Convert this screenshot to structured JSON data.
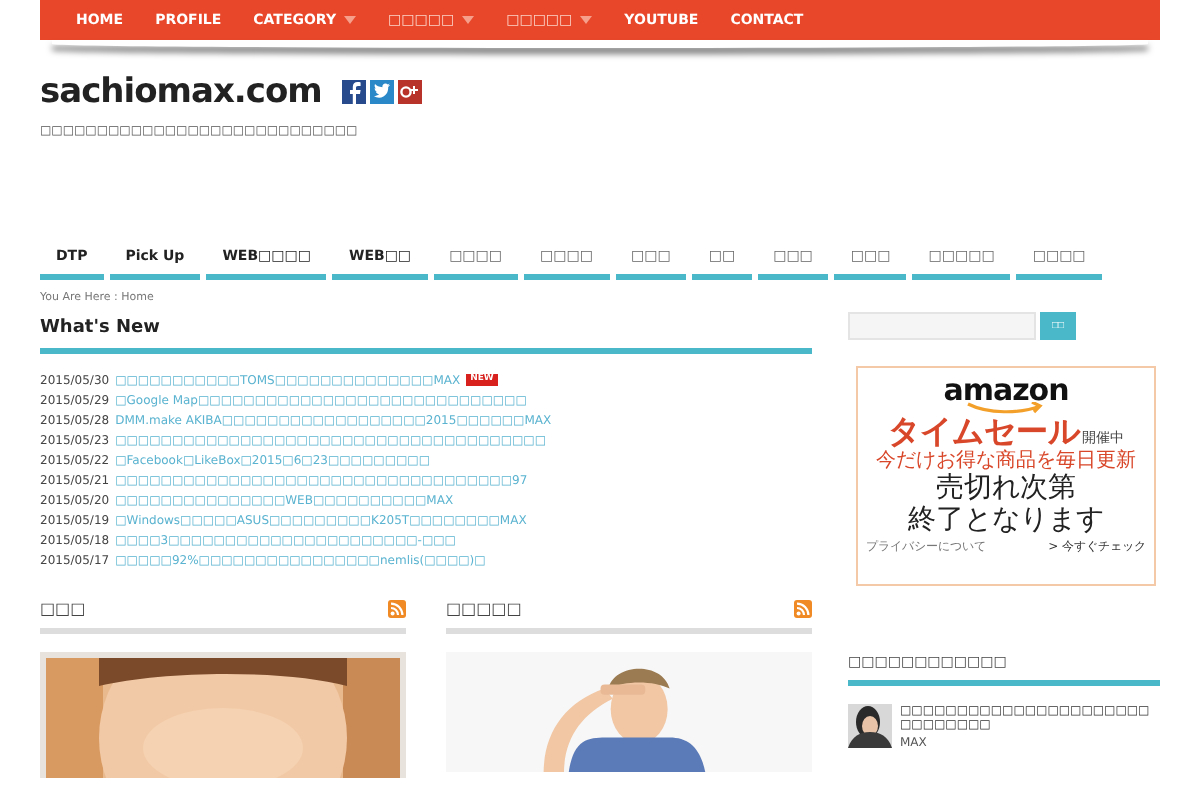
{
  "nav": [
    {
      "label": "HOME",
      "has_menu": false
    },
    {
      "label": "PROFILE",
      "has_menu": false
    },
    {
      "label": "CATEGORY",
      "has_menu": true
    },
    {
      "label": "□□□□□",
      "has_menu": true
    },
    {
      "label": "□□□□□",
      "has_menu": true
    },
    {
      "label": "YOUTUBE",
      "has_menu": false
    },
    {
      "label": "CONTACT",
      "has_menu": false
    }
  ],
  "site": {
    "title": "sachiomax.com",
    "tagline": "□□□□□□□□□□□□□□□□□□□□□□□□□□□□"
  },
  "categories": [
    "DTP",
    "Pick Up",
    "WEB□□□□",
    "WEB□□",
    "□□□□",
    "□□□□",
    "□□□",
    "□□",
    "□□□",
    "□□□",
    "□□□□□",
    "□□□□"
  ],
  "breadcrumb": "You Are Here : Home",
  "whats_new": {
    "title": "What's New",
    "items": [
      {
        "date": "2015/05/30",
        "title": "□□□□□□□□□□□TOMS□□□□□□□□□□□□□□MAX",
        "new": true
      },
      {
        "date": "2015/05/29",
        "title": "□Google Map□□□□□□□□□□□□□□□□□□□□□□□□□□□□□",
        "new": false
      },
      {
        "date": "2015/05/28",
        "title": "DMM.make AKIBA□□□□□□□□□□□□□□□□□□2015□□□□□□MAX",
        "new": false
      },
      {
        "date": "2015/05/23",
        "title": "□□□□□□□□□□□□□□□□□□□□□□□□□□□□□□□□□□□□□□",
        "new": false
      },
      {
        "date": "2015/05/22",
        "title": "□Facebook□LikeBox□2015□6□23□□□□□□□□□",
        "new": false
      },
      {
        "date": "2015/05/21",
        "title": "□□□□□□□□□□□□□□□□□□□□□□□□□□□□□□□□□□□97",
        "new": false
      },
      {
        "date": "2015/05/20",
        "title": "□□□□□□□□□□□□□□□WEB□□□□□□□□□□MAX",
        "new": false
      },
      {
        "date": "2015/05/19",
        "title": "□Windows□□□□□ASUS□□□□□□□□□K205T□□□□□□□□MAX",
        "new": false
      },
      {
        "date": "2015/05/18",
        "title": "□□□□3□□□□□□□□□□□□□□□□□□□□□□-□□□",
        "new": false
      },
      {
        "date": "2015/05/17",
        "title": "□□□□□92%□□□□□□□□□□□□□□□□nemlis(□□□□)□",
        "new": false
      }
    ]
  },
  "new_badge": "NEW",
  "sections": [
    {
      "title": "□□□"
    },
    {
      "title": "□□□□□"
    }
  ],
  "sidebar": {
    "search_button": "□□",
    "ad": {
      "brand": "amazon",
      "headline": "タイムセール",
      "headline_suffix": "開催中",
      "subline": "今だけお得な商品を毎日更新",
      "line_1": "売切れ次第",
      "line_2": "終了となります",
      "privacy": "プライバシーについて",
      "cta": "> 今すぐチェック"
    },
    "heading": "□□□□□□□□□□□□",
    "post": {
      "title": "□□□□□□□□□□□□□□□□□□□□□□□□□□□□□□",
      "suffix": "MAX"
    }
  }
}
